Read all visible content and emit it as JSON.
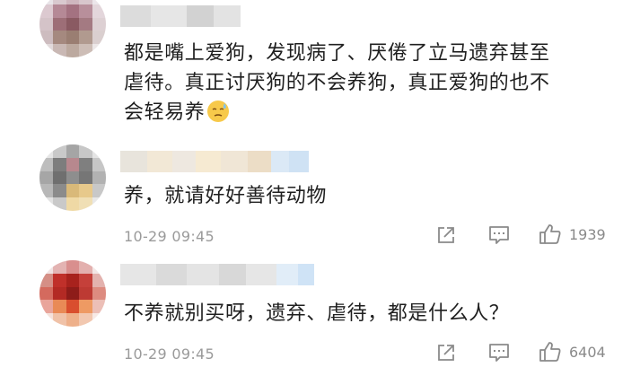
{
  "comments": [
    {
      "text_lines": [
        "都是嘴上爱狗，发现病了、厌倦了立马遗弃甚至",
        "虐待。真正讨厌狗的不会养狗，真正爱狗的也不",
        "会轻易养"
      ],
      "emoji": "sweat-emoji"
    },
    {
      "text_lines": [
        "养，就请好好善待动物"
      ],
      "time": "10-29 09:45",
      "likes": "1939"
    },
    {
      "text_lines": [
        "不养就别买呀，遗弃、虐待，都是什么人？"
      ],
      "time": "10-29 09:45",
      "likes": "6404"
    }
  ],
  "icons": {
    "share": "share-icon",
    "comment": "comment-icon",
    "like": "thumbs-up-icon"
  },
  "colors": {
    "text": "#1f1f1f",
    "meta": "#9a9a9a",
    "icon": "#8a8a8a"
  }
}
